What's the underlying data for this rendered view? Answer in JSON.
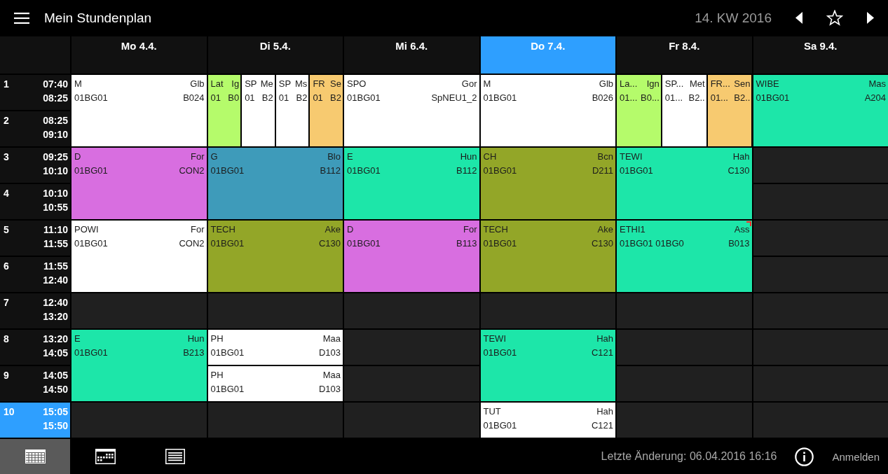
{
  "top_bar": {
    "title": "Mein Stundenplan",
    "week": "14. KW 2016"
  },
  "days": [
    {
      "label": "Mo 4.4.",
      "today": false,
      "slots": [
        {
          "kind": "lesson",
          "double": true,
          "color": "#ffffff",
          "subject": "M",
          "teacher": "Glb",
          "class": "01BG01",
          "room": "B024",
          "has_note": false
        },
        {
          "kind": "lesson",
          "double": true,
          "color": "#d86ee0",
          "subject": "D",
          "teacher": "For",
          "class": "01BG01",
          "room": "CON2",
          "has_note": false
        },
        {
          "kind": "lesson",
          "double": true,
          "color": "#ffffff",
          "subject": "POWI",
          "teacher": "For",
          "class": "01BG01",
          "room": "CON2",
          "has_note": false
        },
        {
          "kind": "free",
          "double": false
        },
        {
          "kind": "lesson",
          "double": true,
          "color": "#1de6a9",
          "subject": "E",
          "teacher": "Hun",
          "class": "01BG01",
          "room": "B213",
          "has_note": false
        },
        {
          "kind": "free",
          "double": false
        }
      ]
    },
    {
      "label": "Di 5.4.",
      "today": false,
      "slots": [
        {
          "kind": "parallel",
          "double": true,
          "lessons": [
            {
              "color": "#b5fb6b",
              "subject": "Lat",
              "teacher": "Ig",
              "class": "01",
              "room": "B0",
              "has_note": false
            },
            {
              "color": "#ffffff",
              "subject": "SP",
              "teacher": "Me",
              "class": "01",
              "room": "B2",
              "has_note": false
            },
            {
              "color": "#ffffff",
              "subject": "SP",
              "teacher": "Ms",
              "class": "01",
              "room": "B2",
              "has_note": false
            },
            {
              "color": "#f7ca70",
              "subject": "FR",
              "teacher": "Se",
              "class": "01",
              "room": "B2",
              "has_note": false
            }
          ]
        },
        {
          "kind": "lesson",
          "double": true,
          "color": "#3e9bba",
          "subject": "G",
          "teacher": "Blo",
          "class": "01BG01",
          "room": "B112",
          "has_note": false
        },
        {
          "kind": "lesson",
          "double": true,
          "color": "#93a628",
          "subject": "TECH",
          "teacher": "Ake",
          "class": "01BG01",
          "room": "C130",
          "has_note": false
        },
        {
          "kind": "free",
          "double": false
        },
        {
          "kind": "lesson",
          "double": false,
          "color": "#ffffff",
          "subject": "PH",
          "teacher": "Maa",
          "class": "01BG01",
          "room": "D103",
          "has_note": false
        },
        {
          "kind": "lesson",
          "double": false,
          "color": "#ffffff",
          "subject": "PH",
          "teacher": "Maa",
          "class": "01BG01",
          "room": "D103",
          "has_note": false
        },
        {
          "kind": "free",
          "double": false
        }
      ]
    },
    {
      "label": "Mi 6.4.",
      "today": false,
      "slots": [
        {
          "kind": "lesson",
          "double": true,
          "color": "#ffffff",
          "subject": "SPO",
          "teacher": "Gor",
          "class": "01BG01",
          "room": "SpNEU1_2",
          "has_note": false
        },
        {
          "kind": "lesson",
          "double": true,
          "color": "#1de6a9",
          "subject": "E",
          "teacher": "Hun",
          "class": "01BG01",
          "room": "B112",
          "has_note": false
        },
        {
          "kind": "lesson",
          "double": true,
          "color": "#d86ee0",
          "subject": "D",
          "teacher": "For",
          "class": "01BG01",
          "room": "B113",
          "has_note": false
        },
        {
          "kind": "free",
          "double": false
        },
        {
          "kind": "free",
          "double": false
        },
        {
          "kind": "free",
          "double": false
        },
        {
          "kind": "free",
          "double": false
        }
      ]
    },
    {
      "label": "Do 7.4.",
      "today": true,
      "slots": [
        {
          "kind": "lesson",
          "double": true,
          "color": "#ffffff",
          "subject": "M",
          "teacher": "Glb",
          "class": "01BG01",
          "room": "B026",
          "has_note": false
        },
        {
          "kind": "lesson",
          "double": true,
          "color": "#93a628",
          "subject": "CH",
          "teacher": "Bcn",
          "class": "01BG01",
          "room": "D211",
          "has_note": false
        },
        {
          "kind": "lesson",
          "double": true,
          "color": "#93a628",
          "subject": "TECH",
          "teacher": "Ake",
          "class": "01BG01",
          "room": "C130",
          "has_note": false
        },
        {
          "kind": "free",
          "double": false
        },
        {
          "kind": "lesson",
          "double": true,
          "color": "#1de6a9",
          "subject": "TEWI",
          "teacher": "Hah",
          "class": "01BG01",
          "room": "C121",
          "has_note": false
        },
        {
          "kind": "lesson",
          "double": false,
          "color": "#ffffff",
          "subject": "TUT",
          "teacher": "Hah",
          "class": "01BG01",
          "room": "C121",
          "has_note": false
        }
      ]
    },
    {
      "label": "Fr 8.4.",
      "today": false,
      "slots": [
        {
          "kind": "parallel",
          "double": true,
          "lessons": [
            {
              "color": "#b5fb6b",
              "subject": "La...",
              "teacher": "Ign",
              "class": "01...",
              "room": "B0...",
              "has_note": false
            },
            {
              "color": "#ffffff",
              "subject": "SP...",
              "teacher": "Met",
              "class": "01...",
              "room": "B2..",
              "has_note": false
            },
            {
              "color": "#f7ca70",
              "subject": "FR...",
              "teacher": "Sen",
              "class": "01...",
              "room": "B2..",
              "has_note": false
            }
          ]
        },
        {
          "kind": "lesson",
          "double": true,
          "color": "#1de6a9",
          "subject": "TEWI",
          "teacher": "Hah",
          "class": "01BG01",
          "room": "C130",
          "has_note": false
        },
        {
          "kind": "lesson",
          "double": true,
          "color": "#1de6a9",
          "subject": "ETHI1",
          "teacher": "Ass",
          "class": "01BG01 01BG0",
          "room": "B013",
          "has_note": true
        },
        {
          "kind": "free",
          "double": false
        },
        {
          "kind": "free",
          "double": false
        },
        {
          "kind": "free",
          "double": false
        },
        {
          "kind": "free",
          "double": false
        }
      ]
    },
    {
      "label": "Sa 9.4.",
      "today": false,
      "slots": [
        {
          "kind": "lesson",
          "double": true,
          "color": "#1de6a9",
          "subject": "WIBE",
          "teacher": "Mas",
          "class": "01BG01",
          "room": "A204",
          "has_note": false
        },
        {
          "kind": "free",
          "double": false
        },
        {
          "kind": "free",
          "double": false
        },
        {
          "kind": "free",
          "double": false
        },
        {
          "kind": "free",
          "double": false
        },
        {
          "kind": "free",
          "double": false
        },
        {
          "kind": "free",
          "double": false
        },
        {
          "kind": "free",
          "double": false
        },
        {
          "kind": "free",
          "double": false
        }
      ]
    }
  ],
  "periods": [
    {
      "number": "1",
      "start": "07:40",
      "end": "08:25",
      "current": false
    },
    {
      "number": "2",
      "start": "08:25",
      "end": "09:10",
      "current": false
    },
    {
      "number": "3",
      "start": "09:25",
      "end": "10:10",
      "current": false
    },
    {
      "number": "4",
      "start": "10:10",
      "end": "10:55",
      "current": false
    },
    {
      "number": "5",
      "start": "11:10",
      "end": "11:55",
      "current": false
    },
    {
      "number": "6",
      "start": "11:55",
      "end": "12:40",
      "current": false
    },
    {
      "number": "7",
      "start": "12:40",
      "end": "13:20",
      "current": false
    },
    {
      "number": "8",
      "start": "13:20",
      "end": "14:05",
      "current": false
    },
    {
      "number": "9",
      "start": "14:05",
      "end": "14:50",
      "current": false
    },
    {
      "number": "10",
      "start": "15:05",
      "end": "15:50",
      "current": true
    }
  ],
  "bottom_bar": {
    "views": [
      {
        "kind": "week",
        "selected": true
      },
      {
        "kind": "month",
        "selected": false
      },
      {
        "kind": "list",
        "selected": false
      }
    ],
    "last_change": "Letzte Änderung: 06.04.2016 16:16",
    "login": "Anmelden"
  }
}
